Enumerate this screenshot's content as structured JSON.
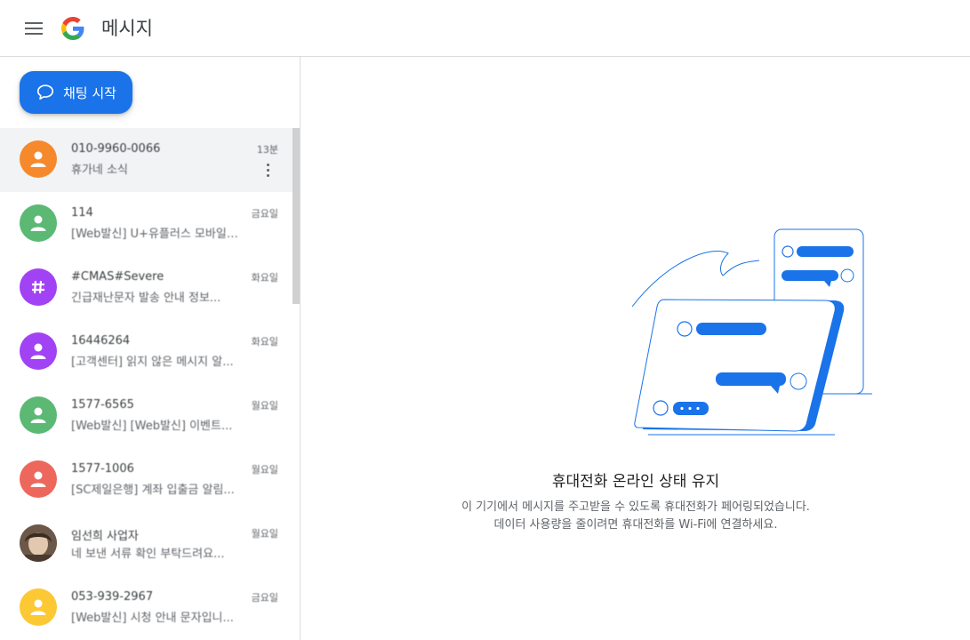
{
  "header": {
    "app_title": "메시지"
  },
  "sidebar": {
    "start_chat_label": "채팅 시작",
    "conversations": [
      {
        "name": "010-9960-0066",
        "snippet": "휴가네 소식",
        "time": "13분",
        "avatar_color": "#f6892c",
        "avatar_type": "person",
        "selected": true
      },
      {
        "name": "114",
        "snippet": "[Web발신] U+유플러스 모바일 데...",
        "time": "금요일",
        "avatar_color": "#5bb974",
        "avatar_type": "person"
      },
      {
        "name": "#CMAS#Severe",
        "snippet": "긴급재난문자 발송 안내 정보...",
        "time": "화요일",
        "avatar_color": "#a142f4",
        "avatar_type": "hash"
      },
      {
        "name": "16446264",
        "snippet": "[고객센터] 읽지 않은 메시지 알...",
        "time": "화요일",
        "avatar_color": "#a142f4",
        "avatar_type": "person"
      },
      {
        "name": "1577-6565",
        "snippet": "[Web발신] [Web발신] 이벤트...",
        "time": "월요일",
        "avatar_color": "#5bb974",
        "avatar_type": "person"
      },
      {
        "name": "1577-1006",
        "snippet": "[SC제일은행] 계좌 입출금 알림...",
        "time": "월요일",
        "avatar_color": "#ee675c",
        "avatar_type": "person"
      },
      {
        "name": "임선희 사업자",
        "snippet": "네 보낸 서류 확인 부탁드려요...",
        "time": "월요일",
        "avatar_color": "#8d7b6a",
        "avatar_type": "photo"
      },
      {
        "name": "053-939-2967",
        "snippet": "[Web발신] 시청 안내 문자입니...",
        "time": "금요일",
        "avatar_color": "#fcc934",
        "avatar_type": "person"
      }
    ]
  },
  "main": {
    "headline": "휴대전화 온라인 상태 유지",
    "desc_line1": "이 기기에서 메시지를 주고받을 수 있도록 휴대전화가 페어링되었습니다.",
    "desc_line2": "데이터 사용량을 줄이려면 휴대전화를 Wi-Fi에 연결하세요."
  },
  "colors": {
    "accent": "#1a73e8",
    "selected_bg": "#f1f3f4",
    "divider": "#dadce0"
  }
}
